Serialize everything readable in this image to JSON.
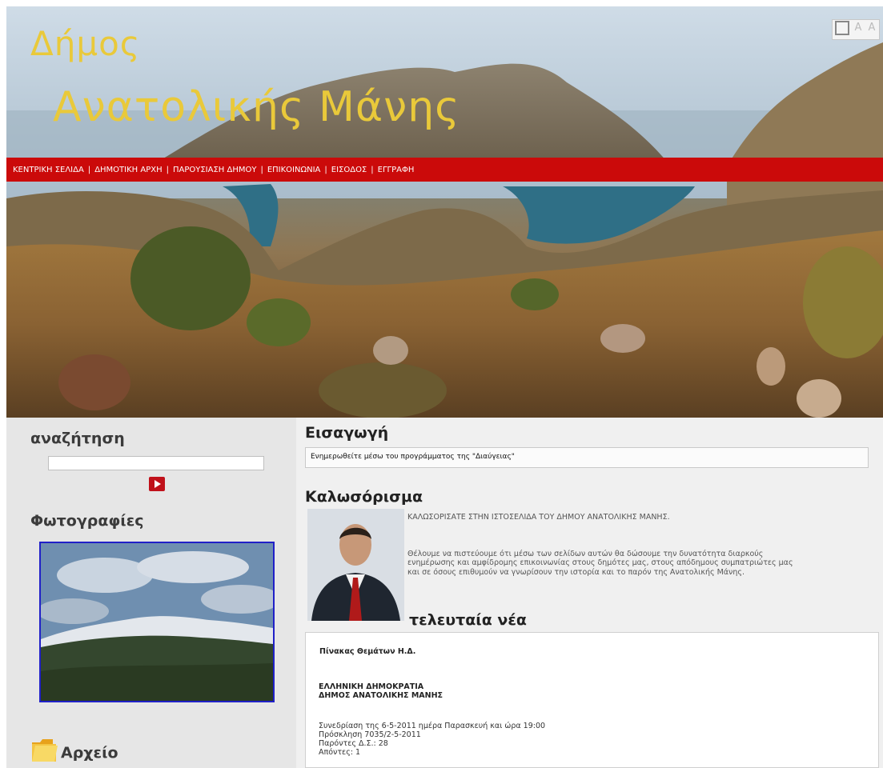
{
  "header": {
    "logo_line1": "Δήμος",
    "logo_line2": "Ανατολικής Μάνης",
    "text_size_tools": [
      "",
      "A",
      "A"
    ]
  },
  "nav": {
    "items": [
      "ΚΕΝΤΡΙΚΗ ΣΕΛΙΔΑ",
      "ΔΗΜΟΤΙΚΗ ΑΡΧΗ",
      "ΠΑΡΟΥΣΙΑΣΗ ΔΗΜΟΥ",
      "ΕΠΙΚΟΙΝΩΝΙΑ",
      "ΕΙΣΟΔΟΣ",
      "ΕΓΓΡΑΦΗ"
    ],
    "separator": "|"
  },
  "sidebar": {
    "search_heading": "αναζήτηση",
    "search_value": "",
    "photos_heading": "Φωτογραφίες",
    "archive_heading": "Αρχείο"
  },
  "main": {
    "intro_heading": "Εισαγωγή",
    "intro_text": "Ενημερωθείτε μέσω του προγράμματος της \"Διαύγειας\"",
    "welcome_heading": "Καλωσόρισμα",
    "welcome_line1": "ΚΑΛΩΣΟΡΙΣΑΤΕ ΣΤΗΝ ΙΣΤΟΣΕΛΙΔΑ ΤΟΥ ΔΗΜΟΥ ΑΝΑΤΟΛΙΚΗΣ ΜΑΝΗΣ.",
    "welcome_para": [
      "Θέλουμε να πιστεύουμε ότι μέσω των σελίδων αυτών θα δώσουμε την δυνατότητα διαρκούς",
      "ενημέρωσης και  αμφίδρομης επικοινωνίας στους δημότες μας, στους απόδημους συμπατριώτες μας",
      "και σε όσους επιθυμούν να γνωρίσουν την ιστορία και το παρόν της Ανατολικής Μάνης."
    ],
    "news_heading": "τελευταία νέα",
    "news": {
      "title": "Πίνακας Θεμάτων Η.Δ.",
      "org1": "ΕΛΛΗΝΙΚΗ ΔΗΜΟΚΡΑΤΙΑ",
      "org2": "ΔΗΜΟΣ   ΑΝΑΤΟΛΙΚΗΣ ΜΑΝΗΣ",
      "lines": [
        "Συνεδρίαση της   6-5-2011 ημέρα Παρασκευή  και  ώρα  19:00",
        "Πρόσκληση  7035/2-5-2011",
        "Παρόντες Δ.Σ.:  28",
        " Απόντες:  1"
      ]
    }
  },
  "colors": {
    "nav_red": "#cb0a0a",
    "logo_gold": "#e9c93a",
    "photo_border": "#2020c8",
    "search_button": "#c0111a"
  }
}
